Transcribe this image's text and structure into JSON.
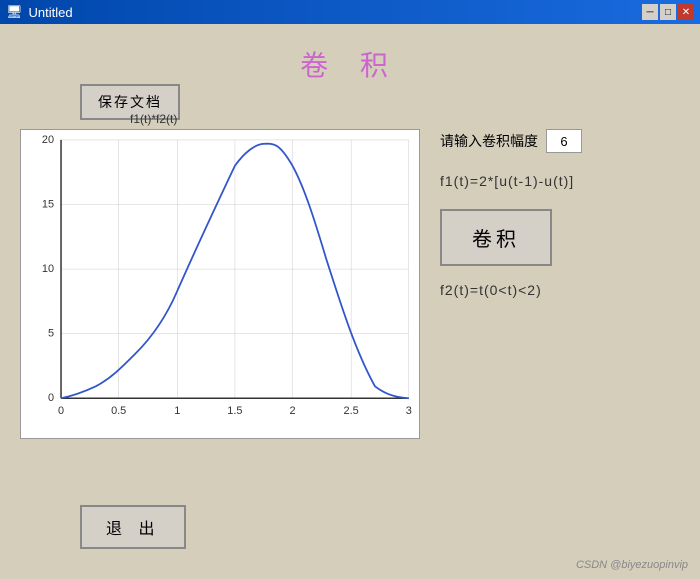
{
  "window": {
    "title": "Untitled",
    "title_icon": "📄"
  },
  "title_bar_buttons": {
    "minimize": "─",
    "maximize": "□",
    "close": "✕"
  },
  "page": {
    "heading": "卷  积"
  },
  "buttons": {
    "save": "保存文档",
    "convolution": "卷积",
    "exit": "退  出"
  },
  "input": {
    "label": "请输入卷积幅度",
    "value": "6",
    "placeholder": "6"
  },
  "formulas": {
    "f1": "f1(t)=2*[u(t-1)-u(t)]",
    "f2": "f2(t)=t(0<t)<2)"
  },
  "chart": {
    "title": "f1(t)*f2(t)",
    "x_max": 3,
    "y_max": 20,
    "x_labels": [
      "0",
      "0.5",
      "1",
      "1.5",
      "2",
      "2.5",
      "3"
    ],
    "y_labels": [
      "0",
      "5",
      "10",
      "15",
      "20"
    ]
  },
  "watermark": "CSDN @biyezuopinvip"
}
